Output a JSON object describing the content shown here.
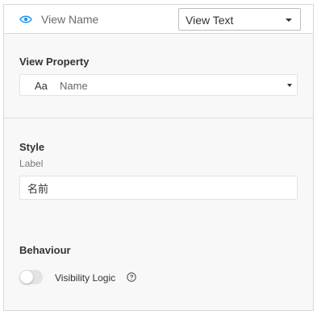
{
  "header": {
    "title": "View Name",
    "view_select": {
      "selected": "View Text"
    }
  },
  "view_property": {
    "title": "View Property",
    "type_icon_text": "Aa",
    "selected": "Name"
  },
  "style": {
    "title": "Style",
    "label_caption": "Label",
    "label_value": "名前"
  },
  "behaviour": {
    "title": "Behaviour",
    "visibility_label": "Visibility Logic",
    "visibility_enabled": false
  },
  "colors": {
    "accent": "#2196f3",
    "border": "#d9d9d9",
    "panel_bg": "#f8f8f8"
  }
}
